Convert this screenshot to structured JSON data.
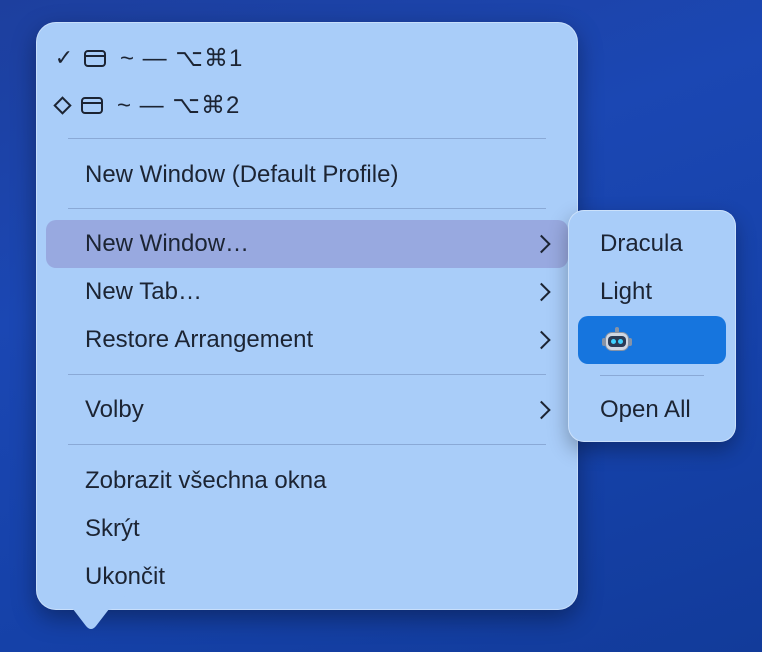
{
  "menu": {
    "windows": [
      {
        "mark": "✓",
        "mark_icon": "checkmark-icon",
        "icon": "window-icon",
        "label": "~ — ⌥⌘1"
      },
      {
        "mark": "◇",
        "mark_icon": "diamond-icon",
        "icon": "window-icon",
        "label": "~ — ⌥⌘2"
      }
    ],
    "new_window_default": "New Window (Default Profile)",
    "new_window": "New Window…",
    "new_tab": "New Tab…",
    "restore_arrangement": "Restore Arrangement",
    "options": "Volby",
    "show_all_windows": "Zobrazit všechna okna",
    "hide": "Skrýt",
    "quit": "Ukončit"
  },
  "submenu": {
    "items": [
      {
        "label": "Dracula"
      },
      {
        "label": "Light"
      },
      {
        "icon": "robot-emoji-icon",
        "selected": true
      }
    ],
    "open_all": "Open All"
  },
  "colors": {
    "menu_bg": "#a9cdf9",
    "highlight": "#98a9e0",
    "selected": "#1675de",
    "desktop": "#1b47b3"
  }
}
